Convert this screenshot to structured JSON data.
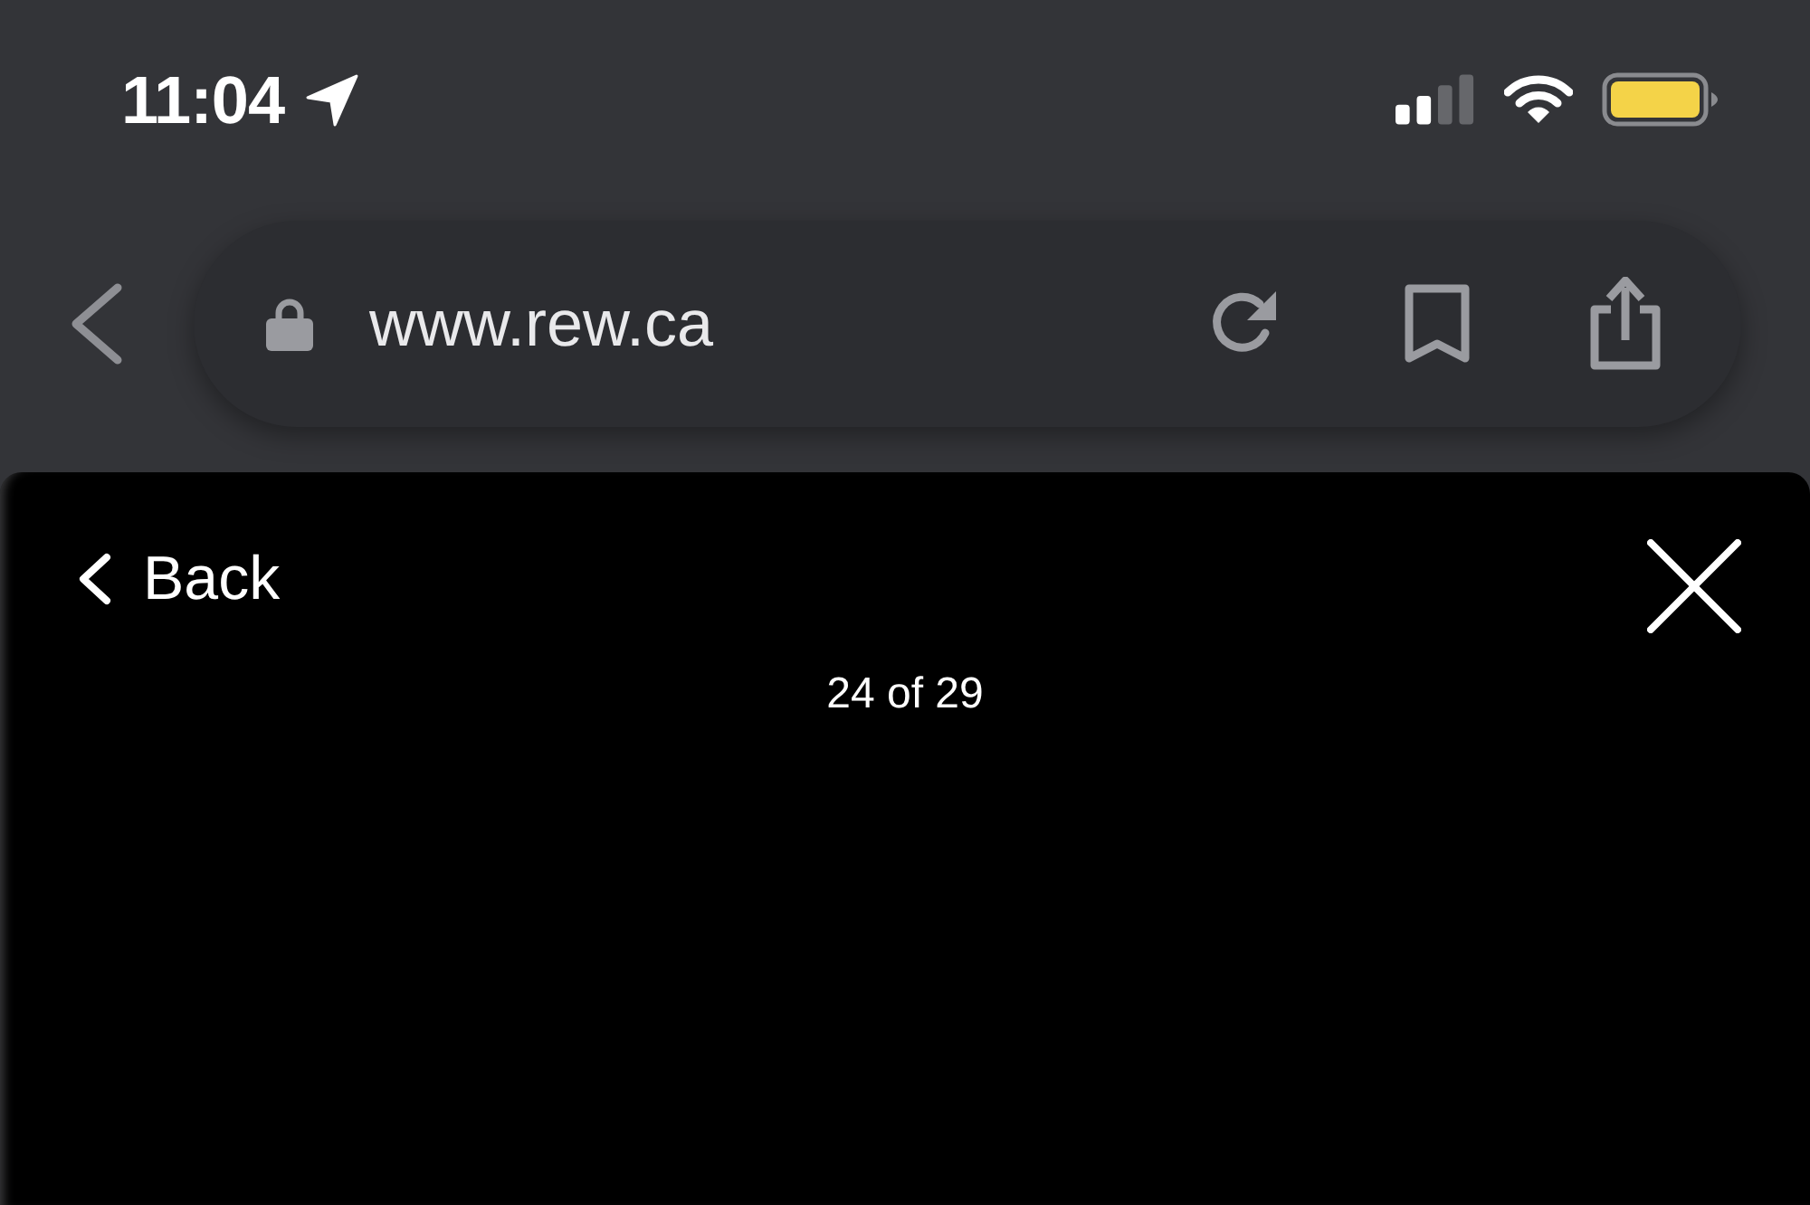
{
  "status_bar": {
    "time": "11:04"
  },
  "browser_bar": {
    "url": "www.rew.ca"
  },
  "gallery": {
    "back_label": "Back",
    "counter": "24 of 29"
  }
}
